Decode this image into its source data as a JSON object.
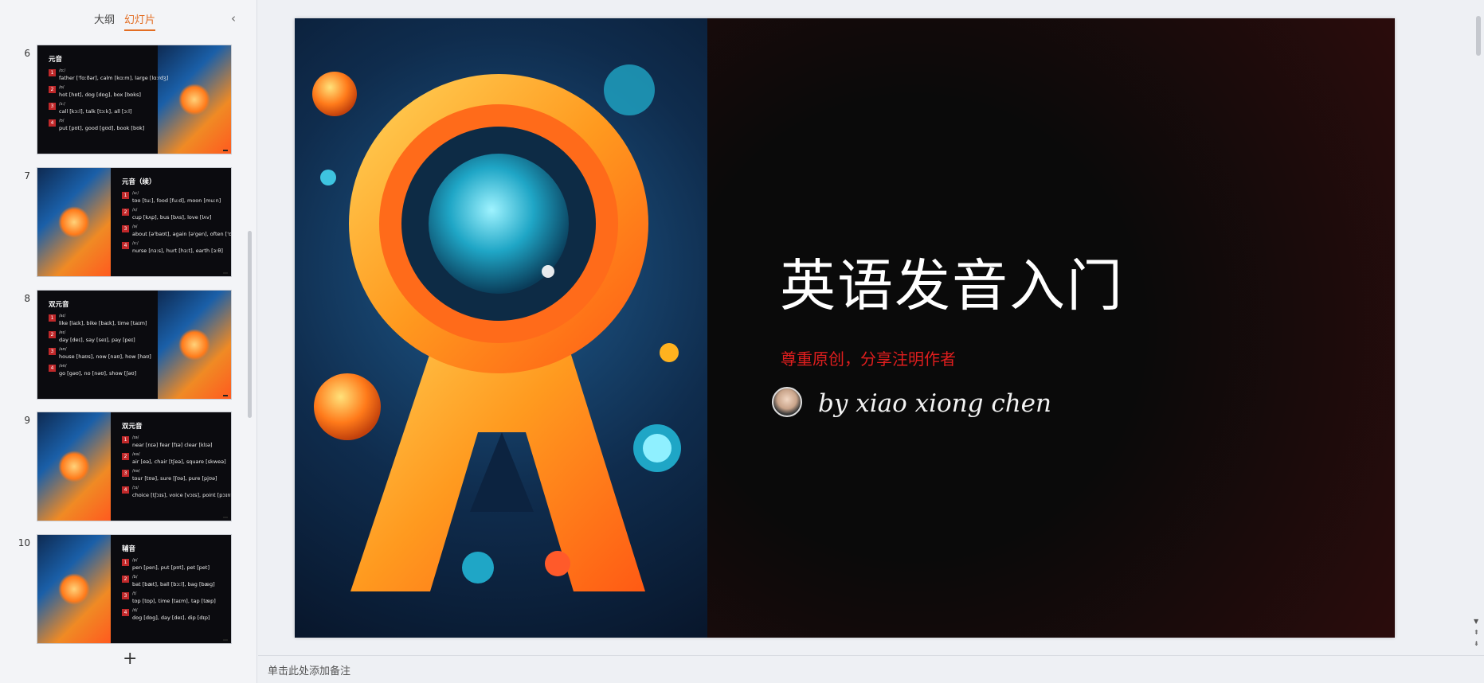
{
  "left_panel": {
    "tabs": [
      {
        "label": "大纲",
        "active": false
      },
      {
        "label": "幻灯片",
        "active": true
      }
    ],
    "collapse_icon": "chevron-left-icon",
    "add_slide_icon": "plus-icon",
    "slides": [
      {
        "number": "6",
        "title": "元音",
        "image_side": "right",
        "items": [
          {
            "badge": "1",
            "phoneme": "/ɑː/",
            "example": "father ['fɑːðər], calm [kɑːm], large [lɑːrdʒ]"
          },
          {
            "badge": "2",
            "phoneme": "/ɒ/",
            "example": "hot [hɒt], dog [dɒg], box [bɒks]"
          },
          {
            "badge": "3",
            "phoneme": "/ɔː/",
            "example": "call [kɔːl], talk [tɔːk], all [ɔːl]"
          },
          {
            "badge": "4",
            "phoneme": "/ʊ/",
            "example": "put [pʊt], good [gʊd], book [bʊk]"
          }
        ]
      },
      {
        "number": "7",
        "title": "元音（续）",
        "image_side": "left",
        "items": [
          {
            "badge": "1",
            "phoneme": "/uː/",
            "example": "too [tuː], food [fuːd], moon [muːn]"
          },
          {
            "badge": "2",
            "phoneme": "/ʌ/",
            "example": "cup [kʌp], bus [bʌs], love [lʌv]"
          },
          {
            "badge": "3",
            "phoneme": "/ə/",
            "example": "about [ə'baʊt], again [ə'gen], often ['ɒfən]"
          },
          {
            "badge": "4",
            "phoneme": "/ɜː/",
            "example": "nurse [nɜːs], hurt [hɜːt], earth [ɜːθ]"
          }
        ]
      },
      {
        "number": "8",
        "title": "双元音",
        "image_side": "right",
        "items": [
          {
            "badge": "1",
            "phoneme": "/aɪ/",
            "example": "like [laɪk], bike [baɪk], time [taɪm]"
          },
          {
            "badge": "2",
            "phoneme": "/eɪ/",
            "example": "day [deɪ], say [seɪ], pay [peɪ]"
          },
          {
            "badge": "3",
            "phoneme": "/aʊ/",
            "example": "house [haʊs], now [naʊ], how [haʊ]"
          },
          {
            "badge": "4",
            "phoneme": "/əʊ/",
            "example": "go [gəʊ], no [nəʊ], show [ʃəʊ]"
          }
        ]
      },
      {
        "number": "9",
        "title": "双元音",
        "image_side": "left",
        "items": [
          {
            "badge": "1",
            "phoneme": "/ɪə/",
            "example": "near [nɪə] fear [fɪə] clear [klɪə]"
          },
          {
            "badge": "2",
            "phoneme": "/eə/",
            "example": "air [eə], chair [tʃeə], square [skweə]"
          },
          {
            "badge": "3",
            "phoneme": "/ʊə/",
            "example": "tour [tʊə], sure [ʃʊə], pure [pjʊə]"
          },
          {
            "badge": "4",
            "phoneme": "/ɔɪ/",
            "example": "choice [tʃɔɪs], voice [vɔɪs], point [pɔɪnt]"
          }
        ]
      },
      {
        "number": "10",
        "title": "辅音",
        "image_side": "left",
        "items": [
          {
            "badge": "1",
            "phoneme": "/p/",
            "example": "pen [pen], put [pʊt], pet [pet]"
          },
          {
            "badge": "2",
            "phoneme": "/b/",
            "example": "bat [bæt], ball [bɔːl], bag [bæg]"
          },
          {
            "badge": "3",
            "phoneme": "/t/",
            "example": "top [tɒp], time [taɪm], tap [tæp]"
          },
          {
            "badge": "4",
            "phoneme": "/d/",
            "example": "dog [dɒg], day [deɪ], dip [dɪp]"
          }
        ]
      }
    ]
  },
  "main_slide": {
    "title": "英语发音入门",
    "subtitle": "尊重原创，分享注明作者",
    "author": "by xiao xiong chen",
    "colors": {
      "background": "#090909",
      "title": "#ffffff",
      "subtitle": "#e01e1e",
      "accent": "#e36d22"
    }
  },
  "notes": {
    "placeholder": "单击此处添加备注"
  }
}
